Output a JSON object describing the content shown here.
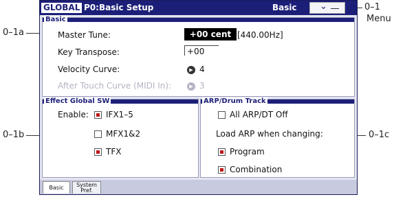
{
  "callouts": {
    "c01": "0–1",
    "menu": "Menu",
    "c01a": "0–1a",
    "c01b": "0–1b",
    "c01c": "0–1c"
  },
  "title_bar": {
    "mode": "GLOBAL",
    "page": "P0:Basic Setup",
    "page_name": "Basic",
    "menu_icon": "chevron-down-icon"
  },
  "basic_panel": {
    "label": "Basic",
    "master_tune_label": "Master Tune:",
    "master_tune_value": "+00 cent",
    "master_tune_hz": "[440.00Hz]",
    "key_transpose_label": "Key Transpose:",
    "key_transpose_value": "+00",
    "velocity_curve_label": "Velocity Curve:",
    "velocity_curve_value": "4",
    "after_touch_label": "After Touch Curve (MIDI In):",
    "after_touch_value": "3"
  },
  "effect_panel": {
    "label": "Effect Global SW",
    "enable_label": "Enable:",
    "items": [
      {
        "label": "IFX1–5",
        "checked": true
      },
      {
        "label": "MFX1&2",
        "checked": false
      },
      {
        "label": "TFX",
        "checked": true
      }
    ]
  },
  "arp_panel": {
    "label": "ARP/Drum Track",
    "all_off_label": "All ARP/DT Off",
    "all_off_checked": false,
    "load_label": "Load ARP when changing:",
    "program_label": "Program",
    "program_checked": true,
    "combination_label": "Combination",
    "combination_checked": true
  },
  "tabs": {
    "basic": "Basic",
    "system_line1": "System",
    "system_line2": "Pref."
  },
  "colors": {
    "title_bar": "#1c1f78",
    "check_mark": "#c01818",
    "screen_bg": "#e4e6f2"
  }
}
